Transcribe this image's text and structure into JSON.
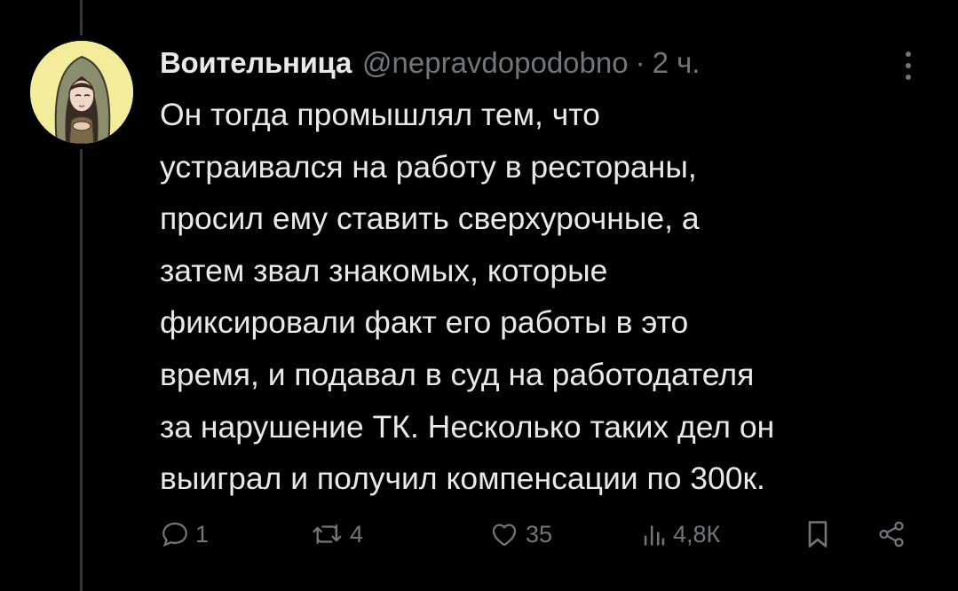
{
  "tweet": {
    "author": {
      "display_name": "Воительница",
      "handle": "@nepravdopodobno",
      "avatar_icon": "avatar-illustration"
    },
    "separator": "·",
    "time": "2 ч.",
    "text_lines": [
      "Он тогда промышлял тем, что",
      "устраивался на работу в рестораны,",
      "просил ему ставить сверхурочные, а",
      "затем звал знакомых, которые",
      "фиксировали факт его работы в это",
      "время, и подавал в суд на работодателя",
      "за нарушение ТК. Несколько таких дел он",
      "выиграл и получил компенсации по 300к."
    ],
    "actions": {
      "replies": "1",
      "retweets": "4",
      "likes": "35",
      "views": "4,8К"
    }
  },
  "colors": {
    "background": "#000000",
    "text": "#e7e9ea",
    "muted": "#71767b",
    "thread_line": "#333639",
    "avatar_bg": "#f3ec9a"
  },
  "icons": [
    "reply-icon",
    "retweet-icon",
    "like-icon",
    "views-icon",
    "bookmark-icon",
    "share-icon",
    "more-icon"
  ]
}
